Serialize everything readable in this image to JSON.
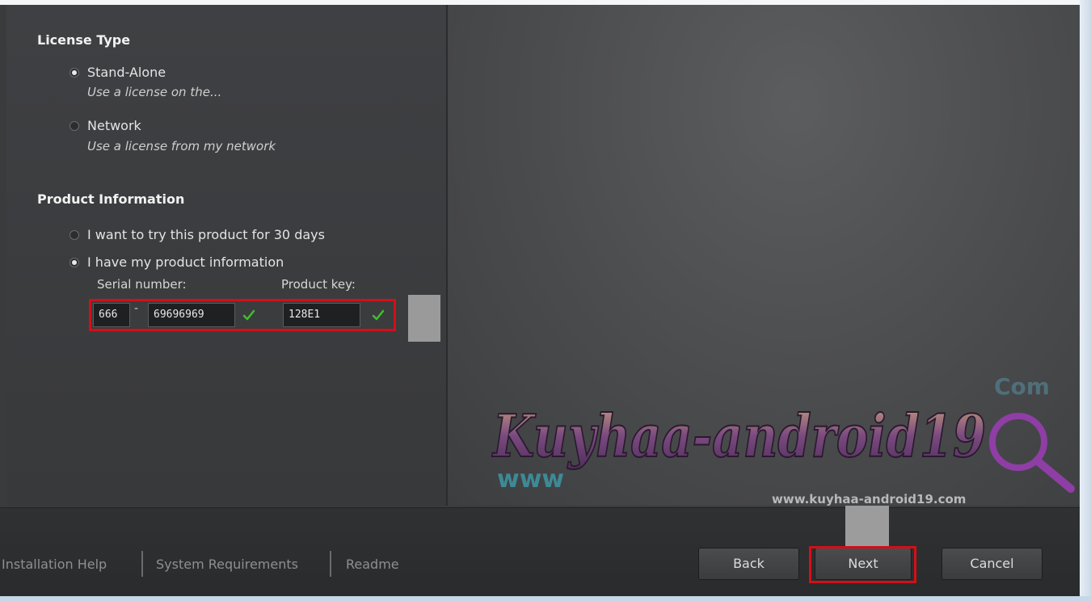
{
  "license_section": {
    "title": "License Type",
    "options": [
      {
        "label": "Stand-Alone",
        "description": "Use a license on the...",
        "selected": true
      },
      {
        "label": "Network",
        "description": "Use a license from my network",
        "selected": false
      }
    ]
  },
  "product_section": {
    "title": "Product Information",
    "options": [
      {
        "label": "I want to try this product for 30 days",
        "selected": false
      },
      {
        "label": "I have my product information",
        "selected": true
      }
    ],
    "serial_label": "Serial number:",
    "product_key_label": "Product key:",
    "serial_prefix": "666",
    "serial_dash": "-",
    "serial_main": "69696969",
    "product_key": "128E1"
  },
  "footer": {
    "links": [
      "Installation Help",
      "System Requirements",
      "Readme"
    ],
    "buttons": {
      "back": "Back",
      "next": "Next",
      "cancel": "Cancel"
    }
  },
  "watermark": {
    "main": "Kuyhaa-android19",
    "com": "Com",
    "www": "www",
    "url": "www.kuyhaa-android19.com"
  },
  "colors": {
    "highlight": "#d40f17",
    "check": "#3fbf2a"
  }
}
